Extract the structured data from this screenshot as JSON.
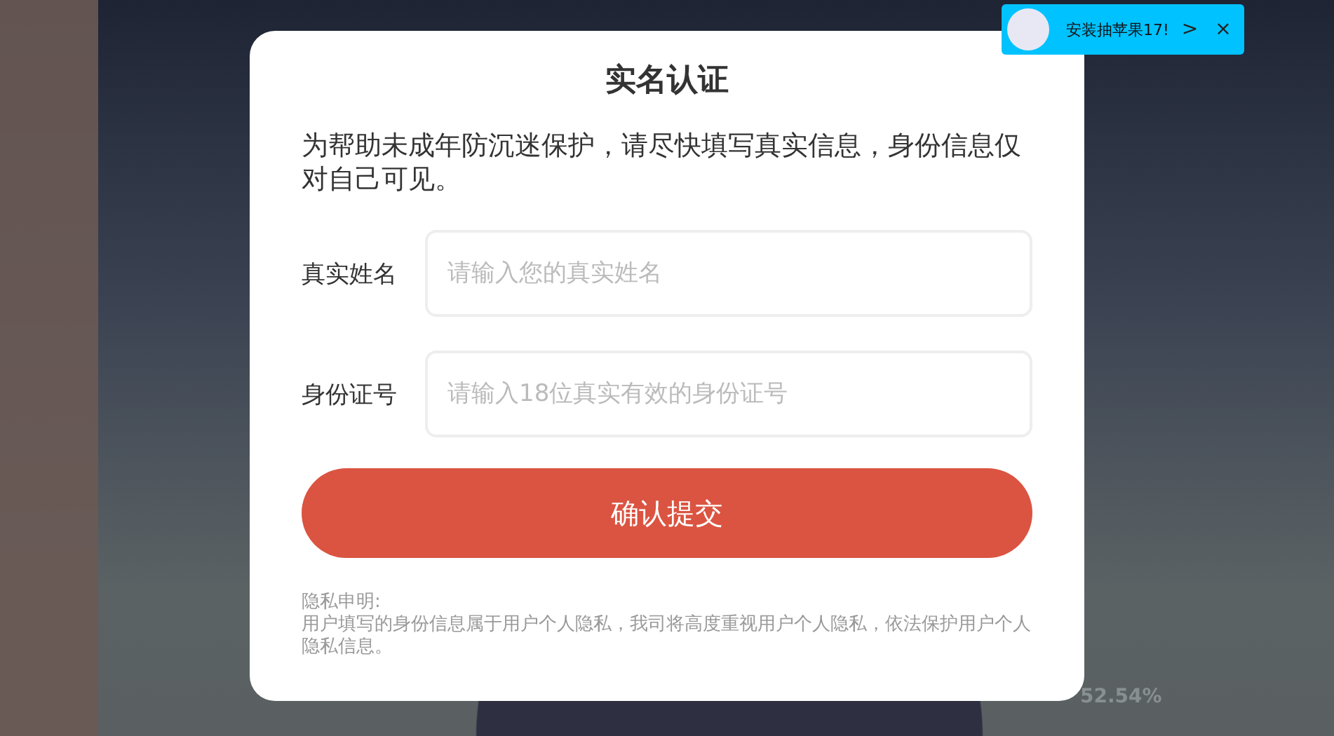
{
  "dialog": {
    "title": "实名认证",
    "intro": "为帮助未成年防沉迷保护，请尽快填写真实信息，身份信息仅对自己可见。",
    "fields": [
      {
        "label": "真实姓名",
        "placeholder": "请输入您的真实姓名"
      },
      {
        "label": "身份证号",
        "placeholder": "请输入18位真实有效的身份证号"
      }
    ],
    "submit": "确认提交",
    "privacy_title": "隐私申明:",
    "privacy_text": "用户填写的身份信息属于用户个人隐私，我司将高度重视用户个人隐私，依法保护用户个人隐私信息。"
  },
  "promo_banner": {
    "text": "安装抽苹果17!",
    "arrow": ">",
    "close": "×"
  },
  "loading_percent": "52.54%"
}
